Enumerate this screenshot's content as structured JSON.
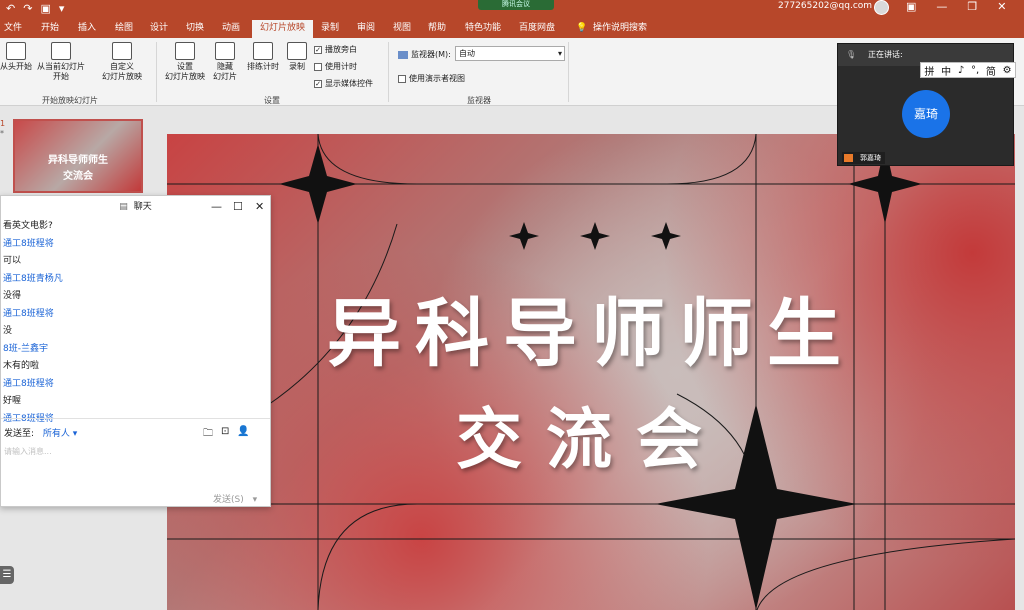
{
  "titlebar": {
    "quick_access": [
      "↶",
      "↷",
      "▣",
      "▾"
    ],
    "center_badge": "腾讯会议",
    "account": "277265202@qq.com",
    "window_controls": [
      "▣",
      "—",
      "❐",
      "✕"
    ]
  },
  "menu": {
    "tabs": [
      "文件",
      "开始",
      "插入",
      "绘图",
      "设计",
      "切换",
      "动画",
      "幻灯片放映",
      "录制",
      "审阅",
      "视图",
      "帮助",
      "特色功能",
      "百度网盘"
    ],
    "active_tab": "幻灯片放映",
    "search": "操作说明搜索"
  },
  "ribbon": {
    "from_start": "从头开始",
    "from_current_1": "从当前幻灯片",
    "from_current_2": "开始",
    "custom_1": "自定义",
    "custom_2": "幻灯片放映",
    "group_start": "开始放映幻灯片",
    "setup_1": "设置",
    "setup_2": "幻灯片放映",
    "hide_1": "隐藏",
    "hide_2": "幻灯片",
    "rehearse": "排练计时",
    "record": "录制",
    "chk_narration": "播放旁白",
    "chk_timings": "使用计时",
    "chk_media": "显示媒体控件",
    "narration_checked": true,
    "timings_checked": false,
    "media_checked": true,
    "group_setup": "设置",
    "monitor_label": "监视器(M):",
    "monitor_value": "自动",
    "presenter_view": "使用演示者视图",
    "group_monitor": "监视器"
  },
  "thumbnail": {
    "index": "1",
    "star": "*",
    "line1": "异科导师师生",
    "line2": "交流会"
  },
  "slide": {
    "title_line1": "异科导师师生",
    "title_line2": "交流会"
  },
  "meeting": {
    "status": "正在讲话:",
    "speaker": "嘉琦",
    "tag": "郭嘉琦"
  },
  "ime_bar": [
    "拼",
    "中",
    "♪",
    "°,",
    "简",
    "⚙"
  ],
  "chat": {
    "title": "聊天",
    "messages": [
      {
        "text": "看英文电影?",
        "type": "text"
      },
      {
        "text": "通工8班程将",
        "type": "name"
      },
      {
        "text": "可以",
        "type": "text"
      },
      {
        "text": "通工8班青杨凡",
        "type": "name"
      },
      {
        "text": "没得",
        "type": "text"
      },
      {
        "text": "通工8班程将",
        "type": "name"
      },
      {
        "text": "没",
        "type": "text"
      },
      {
        "text": "8班-兰鑫宇",
        "type": "name"
      },
      {
        "text": "木有的啦",
        "type": "text"
      },
      {
        "text": "通工8班程将",
        "type": "name"
      },
      {
        "text": "好喔",
        "type": "text"
      },
      {
        "text": "通工8班程将",
        "type": "name"
      }
    ],
    "send_to_label": "发送至:",
    "send_to_value": "所有人 ▾",
    "placeholder": "请输入消息...",
    "send_button": "发送(S)"
  },
  "side_button": "☰"
}
